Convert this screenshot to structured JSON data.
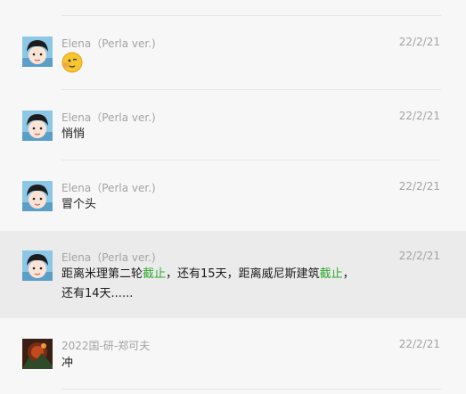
{
  "messages": [
    {
      "sender": "Elena（Perla ver.)",
      "time": "22/2/21",
      "avatar_icon": "cartoon-girl-avatar",
      "emoji_icon": "peek-emoji"
    },
    {
      "sender": "Elena（Perla ver.)",
      "time": "22/2/21",
      "avatar_icon": "cartoon-girl-avatar",
      "text": "悄悄"
    },
    {
      "sender": "Elena（Perla ver.)",
      "time": "22/2/21",
      "avatar_icon": "cartoon-girl-avatar",
      "text": "冒个头"
    },
    {
      "sender": "Elena（Perla ver.)",
      "time": "22/2/21",
      "avatar_icon": "cartoon-girl-avatar",
      "parts": [
        "距离米理第二轮",
        "截止",
        "，还有15天，距离威尼斯建筑",
        "截止",
        "，"
      ],
      "line2": "还有14天......"
    },
    {
      "sender": "2022国-研-郑可夫",
      "time": "22/2/21",
      "avatar_icon": "landscape-photo-avatar",
      "text": "冲"
    }
  ],
  "colors": {
    "keyword": "#2eaa2e",
    "highlight_bg": "#ebebeb",
    "meta_text": "#a3a3a3"
  }
}
